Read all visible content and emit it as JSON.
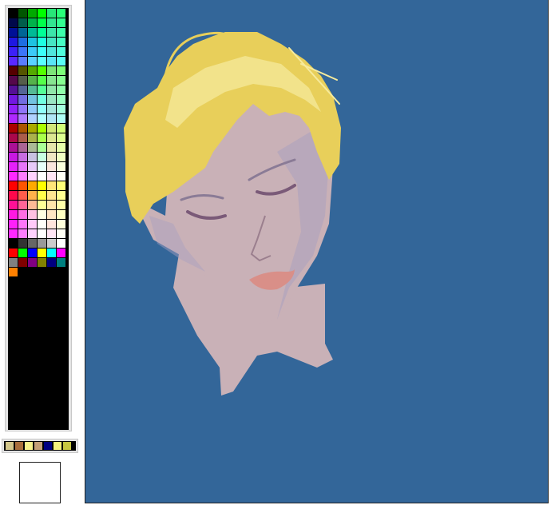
{
  "colors": {
    "canvas_background": "#336699",
    "hair": "#e8cf5a",
    "hair_highlight": "#f6ea9c",
    "skin": "#c9b1b7",
    "skin_shadow": "#a9a0c0",
    "lips": "#d98f88",
    "eyelid": "#7a5a78",
    "current_color": "#ffffff"
  },
  "palette": {
    "block_hue_sets": [
      [
        "#000000",
        "#005500",
        "#00aa00",
        "#00ff00"
      ],
      [
        "#550000",
        "#555500",
        "#55aa00",
        "#55ff00"
      ],
      [
        "#aa0000",
        "#aa5500",
        "#aaaa00",
        "#aaff00"
      ],
      [
        "#ff0000",
        "#ff5500",
        "#ffaa00",
        "#ffff00"
      ]
    ],
    "extra_row_1": [
      "#000000",
      "#333333",
      "#666666",
      "#999999",
      "#cccccc",
      "#ffffff"
    ],
    "extra_row_2": [
      "#ff0000",
      "#00ff00",
      "#0000ff",
      "#ffff00",
      "#00ffff",
      "#ff00ff"
    ],
    "extra_row_3": [
      "#808080",
      "#800000",
      "#800080",
      "#808000",
      "#000080",
      "#008080"
    ],
    "extra_row_4": [
      "#ff8000"
    ]
  },
  "recent_colors": [
    "#d2c68a",
    "#a86e3c",
    "#f7f28c",
    "#c4a078",
    "#000080",
    "#f3f07d",
    "#c6c640"
  ]
}
